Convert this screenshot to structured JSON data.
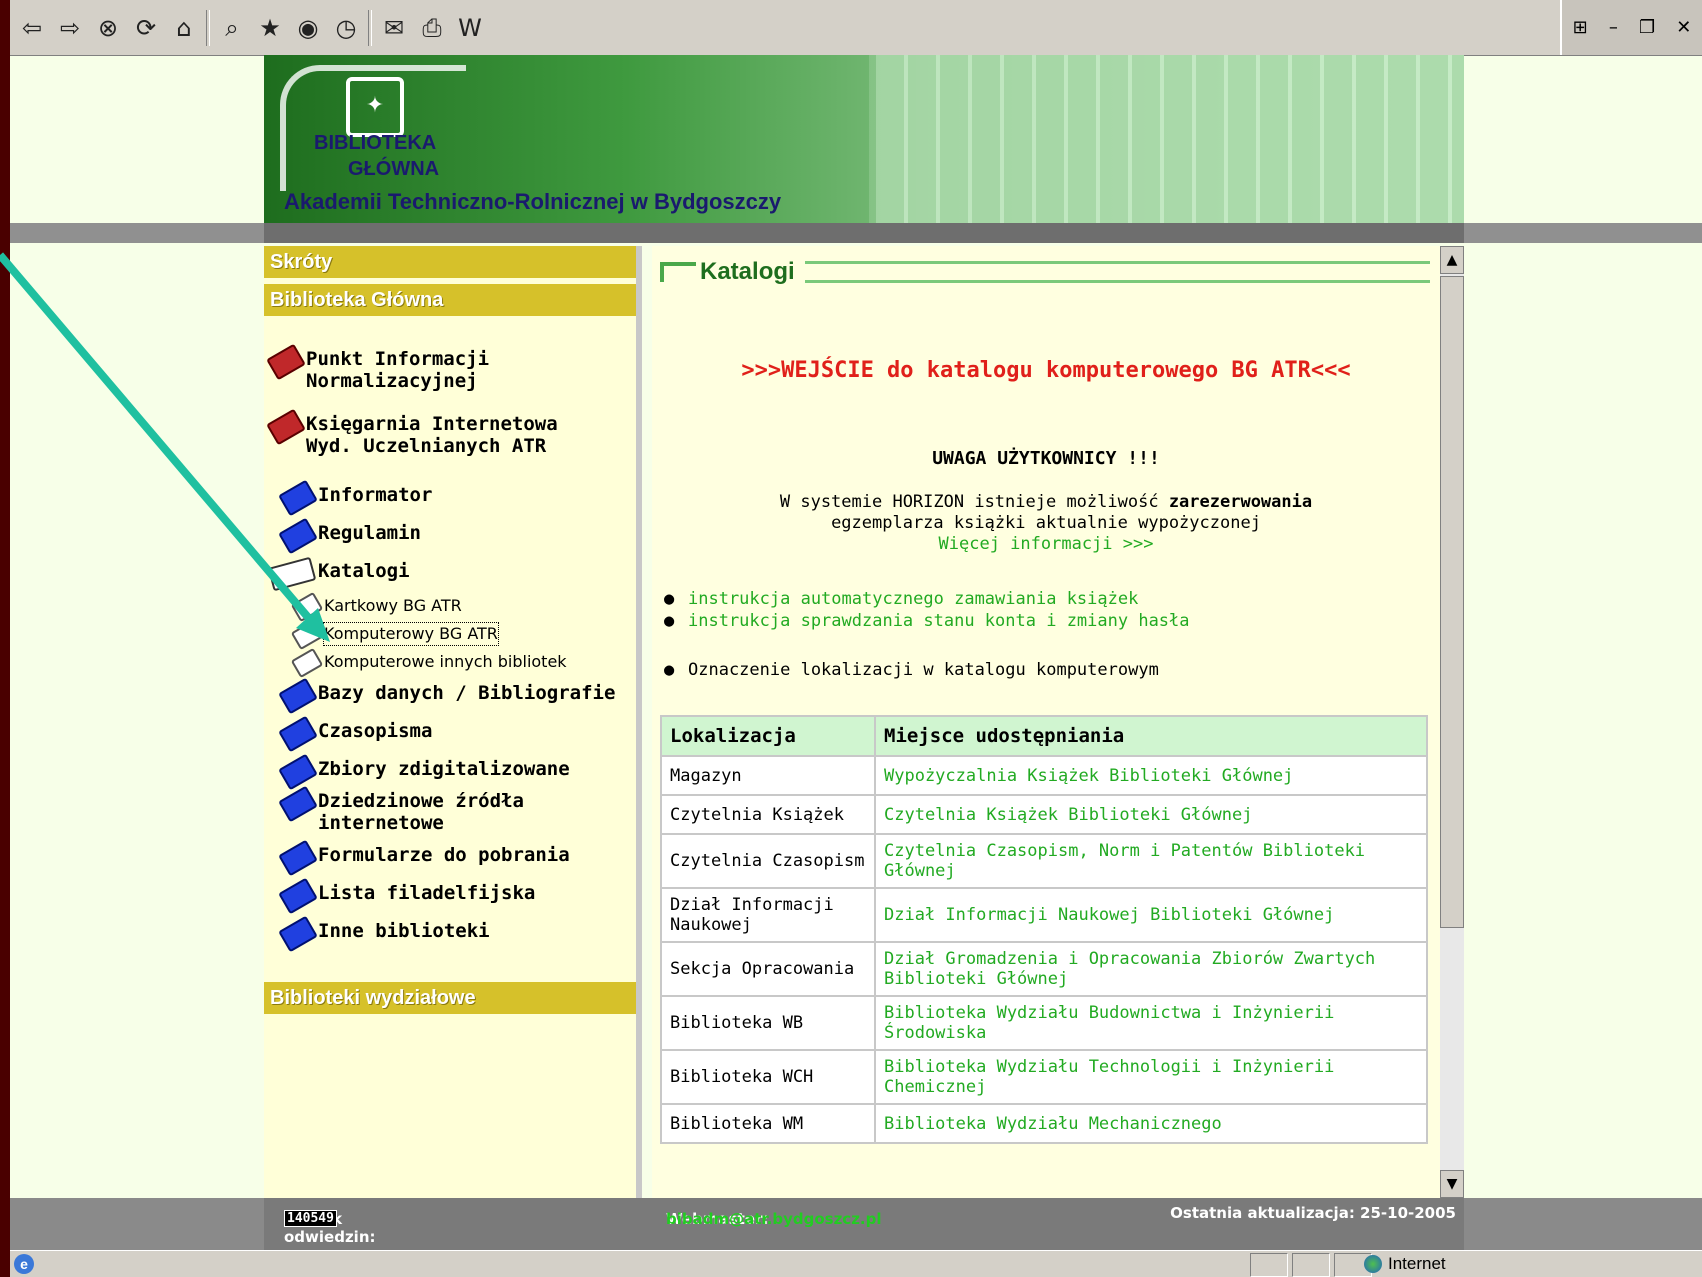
{
  "toolbar": {
    "icons": [
      "back-icon",
      "forward-icon",
      "stop-icon",
      "refresh-icon",
      "home-icon",
      "search-icon",
      "favorites-icon",
      "media-icon",
      "history-icon",
      "mail-icon",
      "print-icon",
      "edit-word-icon"
    ]
  },
  "banner": {
    "line1": "BIBLIOTEKA",
    "line2": "GŁÓWNA",
    "line3": "Akademii Techniczno-Rolnicznej w Bydgoszczy"
  },
  "sidebar": {
    "section_shortcuts": "Skróty",
    "section_main": "Biblioteka Główna",
    "items": [
      {
        "label": "Punkt Informacji\nNormalizacyjnej",
        "icon": "red-book-icon"
      },
      {
        "label": "Księgarnia Internetowa\nWyd. Uczelnianych ATR",
        "icon": "red-book-icon"
      },
      {
        "label": "Informator",
        "icon": "blue-book-icon"
      },
      {
        "label": "Regulamin",
        "icon": "blue-book-icon"
      },
      {
        "label": "Katalogi",
        "icon": "open-book-icon"
      },
      {
        "label": "Kartkowy BG ATR",
        "icon": "page-icon"
      },
      {
        "label": "Komputerowy BG ATR",
        "icon": "page-icon"
      },
      {
        "label": "Komputerowe innych bibliotek",
        "icon": "page-icon"
      },
      {
        "label": "Bazy danych / Bibliografie",
        "icon": "blue-book-icon"
      },
      {
        "label": "Czasopisma",
        "icon": "blue-book-icon"
      },
      {
        "label": "Zbiory zdigitalizowane",
        "icon": "blue-book-icon"
      },
      {
        "label": "Dziedzinowe źródła\ninternetowe",
        "icon": "blue-book-icon"
      },
      {
        "label": "Formularze do pobrania",
        "icon": "blue-book-icon"
      },
      {
        "label": "Lista filadelfijska",
        "icon": "blue-book-icon"
      },
      {
        "label": "Inne biblioteki",
        "icon": "blue-book-icon"
      }
    ],
    "section_faculty": "Biblioteki wydziałowe"
  },
  "content": {
    "title": "Katalogi",
    "entry_link": ">>>WEJŚCIE do katalogu komputerowego BG ATR<<<",
    "warning_title": "UWAGA UŻYTKOWNICY !!!",
    "info_line1_a": "W systemie HORIZON istnieje możliwość ",
    "info_line1_b": "zarezerwowania",
    "info_line2": "egzemplarza książki aktualnie wypożyczonej",
    "info_more": "Więcej informacji >>>",
    "bullet1": "instrukcja automatycznego zamawiania książek",
    "bullet2": "instrukcja sprawdzania stanu konta i zmiany hasła",
    "bullet3": "Oznaczenie lokalizacji w katalogu komputerowym",
    "table": {
      "headers": [
        "Lokalizacja",
        "Miejsce udostępniania"
      ],
      "rows": [
        [
          "Magazyn",
          "Wypożyczalnia Książek Biblioteki Głównej"
        ],
        [
          "Czytelnia Książek",
          "Czytelnia Książek Biblioteki Głównej"
        ],
        [
          "Czytelnia Czasopism",
          "Czytelnia Czasopism, Norm i Patentów Biblioteki Głównej"
        ],
        [
          "Dział Informacji Naukowej",
          "Dział Informacji Naukowej Biblioteki Głównej"
        ],
        [
          "Sekcja Opracowania",
          "Dział Gromadzenia i Opracowania Zbiorów Zwartych Biblioteki Głównej"
        ],
        [
          "Biblioteka WB",
          "Biblioteka Wydziału Budownictwa i Inżynierii Środowiska"
        ],
        [
          "Biblioteka WCH",
          "Biblioteka Wydziału Technologii i Inżynierii Chemicznej"
        ],
        [
          "Biblioteka WM",
          "Biblioteka Wydziału Mechanicznego"
        ]
      ]
    }
  },
  "footer": {
    "counter_label": "Licznik odwiedzin:",
    "counter_value": "140549",
    "webmaster_label": "Webmaster:",
    "webmaster_email": "bibadm@atr.bydgoszcz.pl",
    "update_label": "Ostatnia aktualizacja: 25-10-2005"
  },
  "statusbar": {
    "zone": "Internet"
  },
  "colors": {
    "accent_green": "#22aa22",
    "section_yellow": "#d6c12a",
    "link_red": "#e0201a",
    "arrow": "#1fc0a0"
  }
}
